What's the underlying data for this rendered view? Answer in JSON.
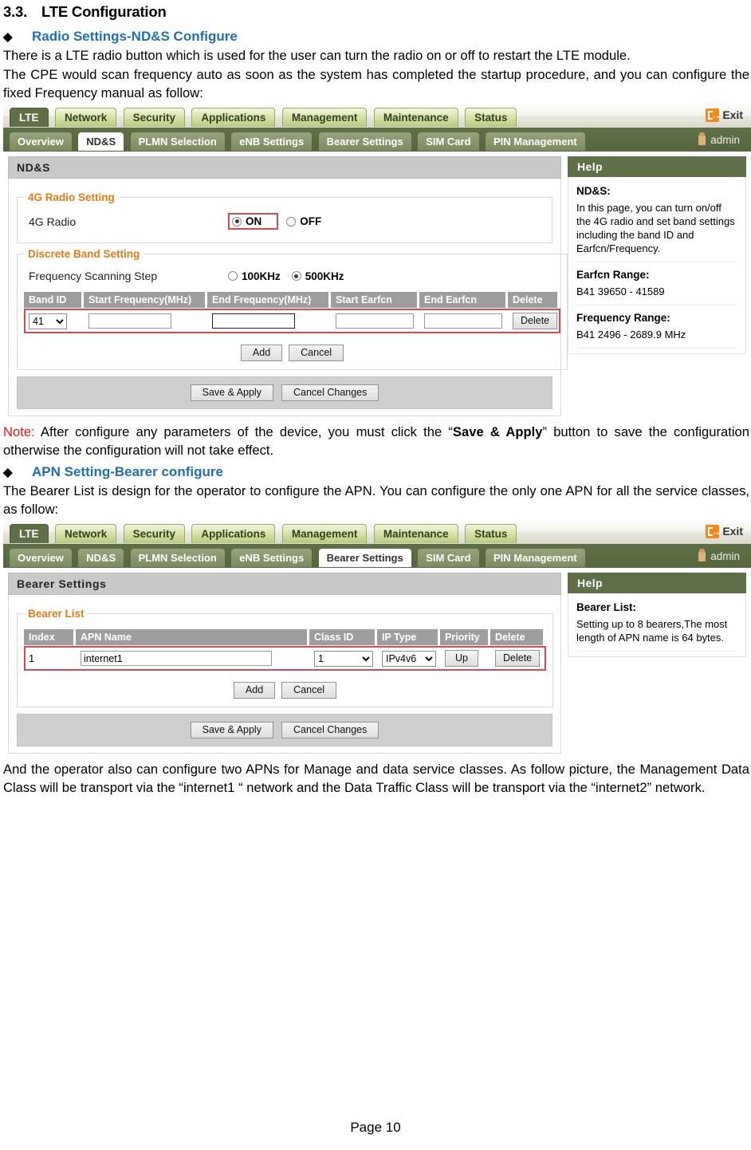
{
  "doc": {
    "section_number": "3.3.",
    "section_title": "LTE Configuration",
    "bullet1": "Radio Settings-ND&S Configure",
    "para1": "There is a LTE radio button which is used for the user can turn the radio on or off to restart the LTE module.",
    "para2": "The CPE would scan frequency auto as soon as the system has completed the startup procedure, and you can configure the fixed Frequency manual as follow:",
    "note_label": "Note:",
    "note_part1": " After configure any parameters of the device, you must click the “",
    "note_bold": "Save & Apply",
    "note_part2": "” button to save the configuration otherwise the configuration will not take effect.",
    "bullet2": "APN Setting-Bearer configure",
    "para3": "The Bearer List is design for the operator to configure the APN. You can configure the only one APN for all the service classes, as follow:",
    "para4": "And the operator also can configure two APNs for Manage and data service classes. As follow picture, the Management Data Class will be transport via the “internet1 “ network and the Data Traffic Class will be transport via the “internet2” network.",
    "footer": "Page 10",
    "diamond": "◆"
  },
  "nav": {
    "tabs": [
      "LTE",
      "Network",
      "Security",
      "Applications",
      "Management",
      "Maintenance",
      "Status"
    ],
    "active_tab": "LTE",
    "exit_label": "Exit",
    "exit_icon": "exit-icon",
    "user_label": "admin",
    "user_icon": "user-icon"
  },
  "subnav": {
    "tabs": [
      "Overview",
      "ND&S",
      "PLMN Selection",
      "eNB Settings",
      "Bearer Settings",
      "SIM Card",
      "PIN Management"
    ]
  },
  "screen1": {
    "active_subtab": "ND&S",
    "panel_title": "ND&S",
    "radio_group_legend": "4G Radio Setting",
    "radio_label": "4G Radio",
    "radio_options": [
      {
        "label": "ON",
        "selected": true
      },
      {
        "label": "OFF",
        "selected": false
      }
    ],
    "band_group_legend": "Discrete Band Setting",
    "scan_step_label": "Frequency Scanning Step",
    "scan_step_options": [
      {
        "label": "100KHz",
        "selected": false
      },
      {
        "label": "500KHz",
        "selected": true
      }
    ],
    "table_headers": [
      "Band ID",
      "Start Frequency(MHz)",
      "End Frequency(MHz)",
      "Start Earfcn",
      "End Earfcn",
      "Delete"
    ],
    "row": {
      "band_id": "41",
      "start_freq": "",
      "end_freq": "",
      "start_earfcn": "",
      "end_earfcn": "",
      "delete_label": "Delete"
    },
    "add_label": "Add",
    "cancel_label": "Cancel",
    "save_label": "Save & Apply",
    "cancel_changes_label": "Cancel Changes",
    "help": {
      "title": "Help",
      "sections": [
        {
          "heading": "ND&S:",
          "text": "In this page, you can turn on/off the 4G radio and set band settings including the band ID and Earfcn/Frequency."
        },
        {
          "heading": "Earfcn Range:",
          "text": "B41 39650 - 41589"
        },
        {
          "heading": "Frequency Range:",
          "text": "B41 2496 - 2689.9 MHz"
        }
      ]
    }
  },
  "screen2": {
    "active_subtab": "Bearer Settings",
    "panel_title": "Bearer Settings",
    "group_legend": "Bearer List",
    "table_headers": [
      "Index",
      "APN Name",
      "Class ID",
      "IP Type",
      "Priority",
      "Delete"
    ],
    "row": {
      "index": "1",
      "apn_name": "internet1",
      "class_id": "1",
      "ip_type": "IPv4v6",
      "priority_label": "Up",
      "delete_label": "Delete"
    },
    "add_label": "Add",
    "cancel_label": "Cancel",
    "save_label": "Save & Apply",
    "cancel_changes_label": "Cancel Changes",
    "help": {
      "title": "Help",
      "sections": [
        {
          "heading": "Bearer List:",
          "text": "Setting up to 8 bearers,The most length of APN name is 64 bytes."
        }
      ]
    }
  },
  "colors": {
    "accent_blue": "#1f6fb5",
    "note_red": "#e8170f",
    "highlight_red": "#d94b4b",
    "legend_orange": "#e07b17",
    "nav_green": "#5f6f48",
    "exit_orange": "#f08a1c"
  }
}
